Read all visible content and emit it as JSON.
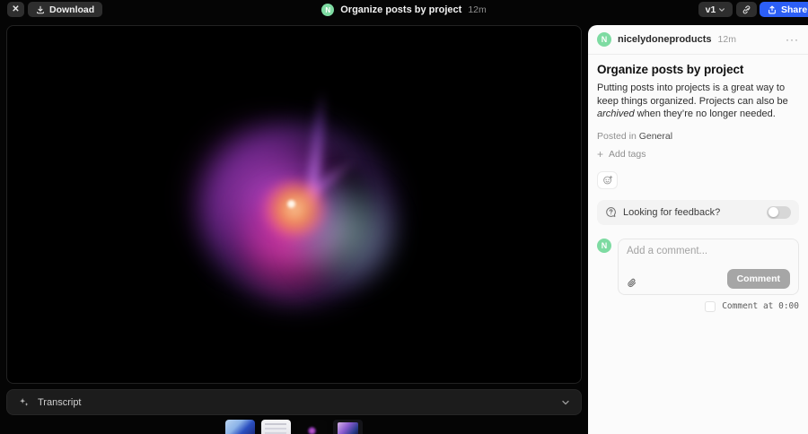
{
  "topbar": {
    "close_icon": "✕",
    "download_label": "Download",
    "avatar_initial": "N",
    "title": "Organize posts by project",
    "duration": "12m",
    "version_label": "v1",
    "share_label": "Share"
  },
  "transcript": {
    "label": "Transcript"
  },
  "sidebar": {
    "author": {
      "avatar_initial": "N",
      "name": "nicelydoneproducts",
      "time": "12m",
      "menu_icon": "···"
    },
    "post": {
      "title": "Organize posts by project",
      "description_part1": "Putting posts into projects is a great way to keep things organized. Projects can also be ",
      "description_italic": "archived",
      "description_part2": " when they’re no longer needed.",
      "posted_in_label": "Posted in ",
      "posted_in_value": "General",
      "add_tags_plus": "+",
      "add_tags_label": "Add tags"
    },
    "feedback": {
      "label": "Looking for feedback?",
      "toggle_on": false
    },
    "composer": {
      "avatar_initial": "N",
      "placeholder": "Add a comment...",
      "comment_button_label": "Comment",
      "comment_at_label": "Comment at 0:00"
    }
  },
  "colors": {
    "accent_blue": "#2c5ff6",
    "avatar_green": "#7edba2",
    "button_dark": "#2e2e2e"
  }
}
